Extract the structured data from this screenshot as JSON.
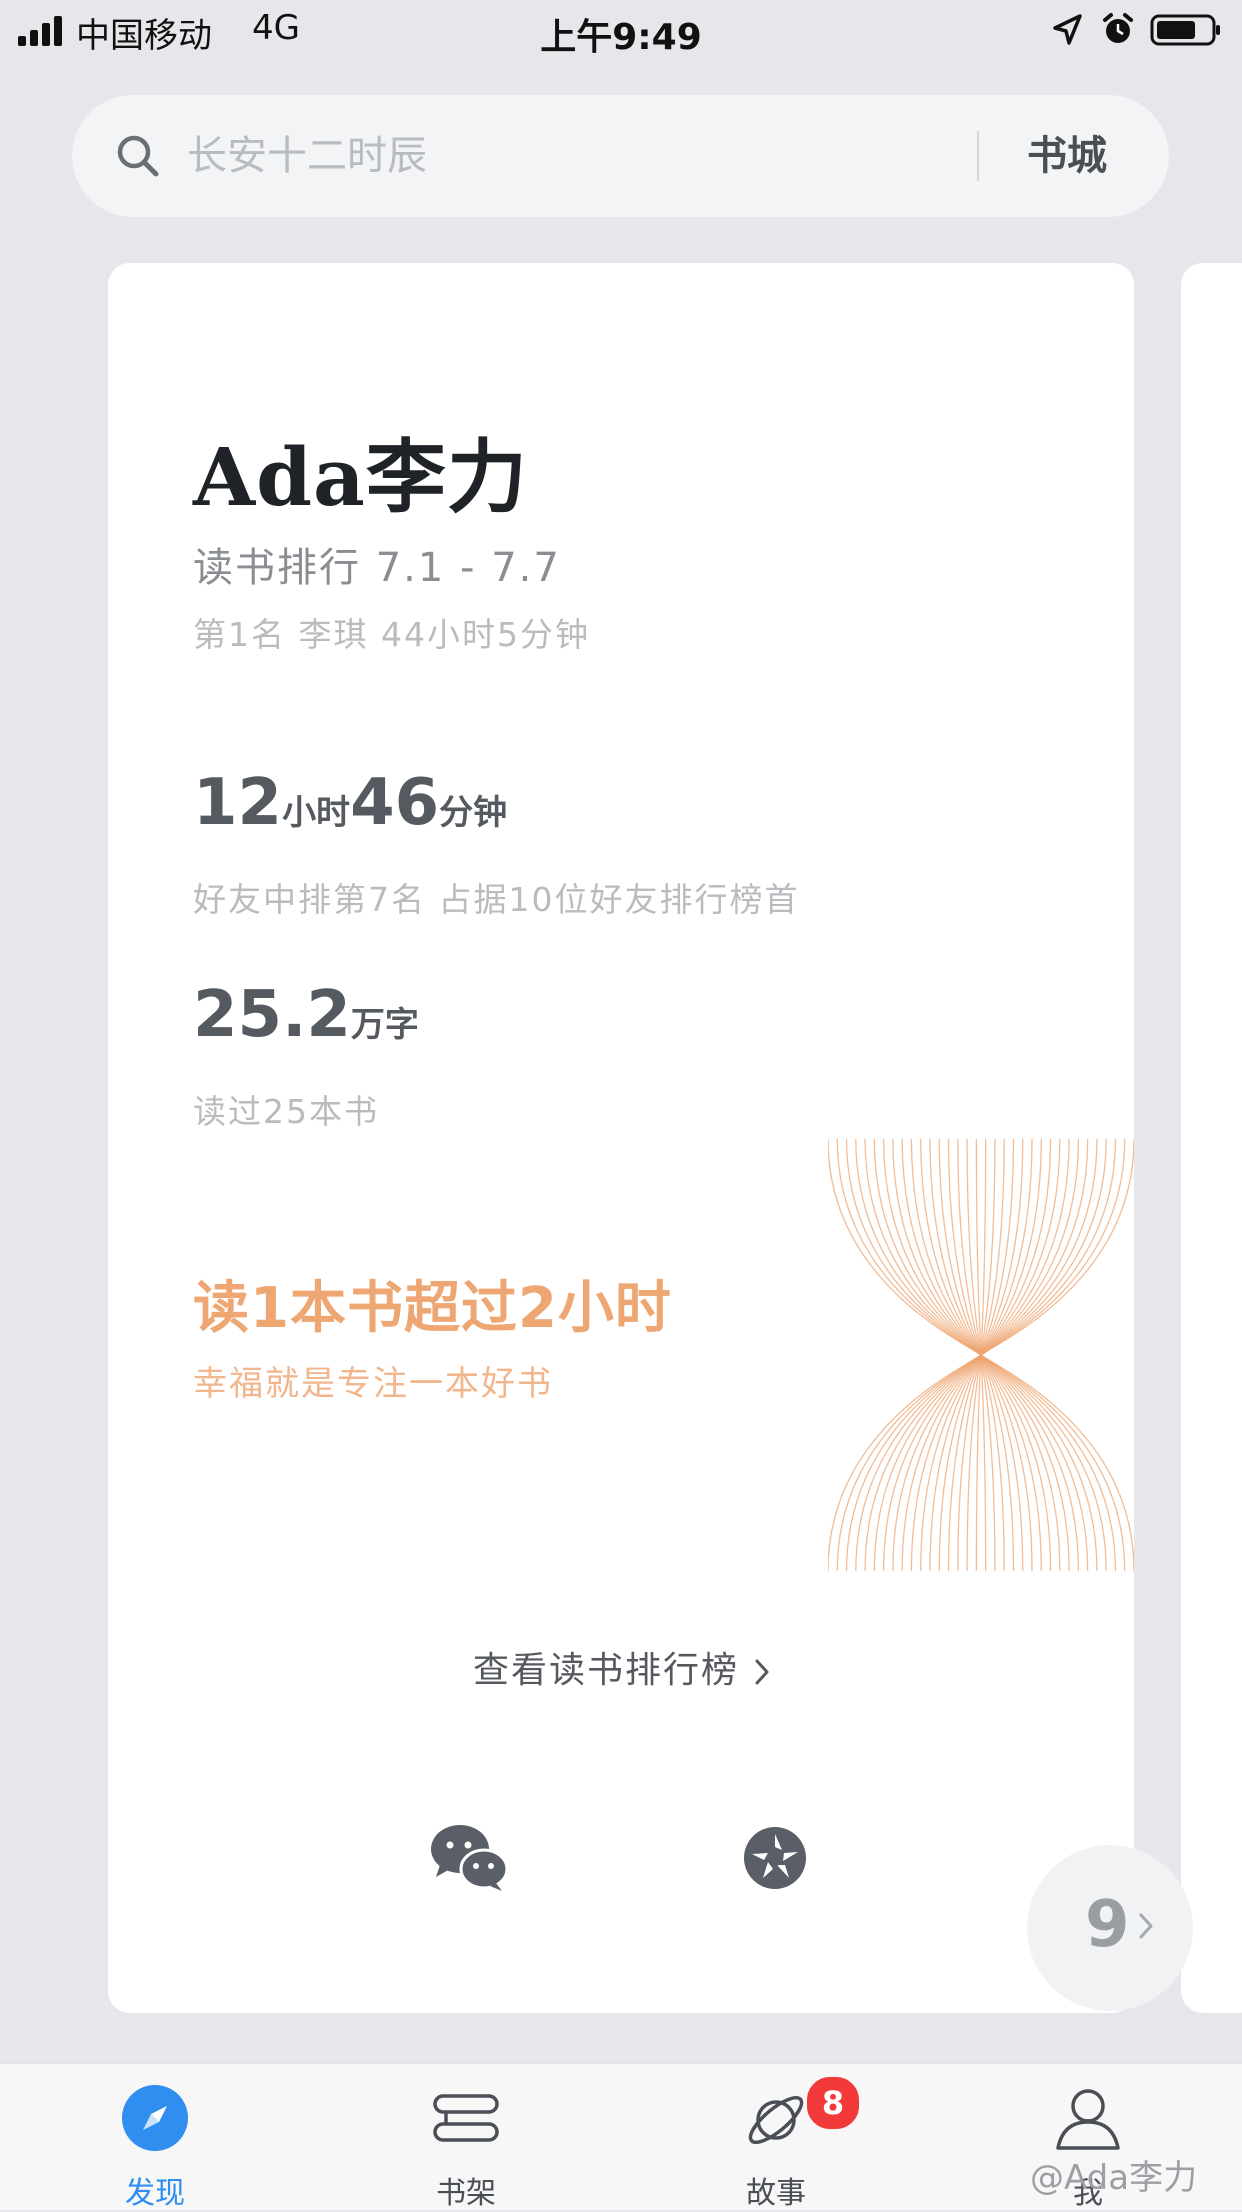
{
  "status_bar": {
    "carrier": "中国移动",
    "network": "4G",
    "time": "上午9:49"
  },
  "search": {
    "placeholder": "长安十二时辰",
    "bookstore_label": "书城"
  },
  "card": {
    "user_name": "Ada李力",
    "rank_title": "读书排行 7.1 - 7.7",
    "rank_first": "第1名 李琪 44小时5分钟",
    "reading_time": {
      "hours": "12",
      "hours_unit": "小时",
      "minutes": "46",
      "minutes_unit": "分钟"
    },
    "time_subtitle": "好友中排第7名 占据10位好友排行榜首",
    "words": {
      "value": "25.2",
      "unit": "万字"
    },
    "words_subtitle": "读过25本书",
    "achievement_title": "读1本书超过2小时",
    "achievement_subtitle": "幸福就是专注一本好书",
    "view_rank_label": "查看读书排行榜",
    "share_icons": [
      "wechat-icon",
      "moments-icon"
    ],
    "accent_color": "#eea672"
  },
  "page_indicator": {
    "number": "9"
  },
  "tab_bar": {
    "tabs": [
      {
        "label": "发现",
        "icon": "compass-icon",
        "active": true
      },
      {
        "label": "书架",
        "icon": "bookshelf-icon",
        "active": false
      },
      {
        "label": "故事",
        "icon": "planet-icon",
        "active": false,
        "badge": "8"
      },
      {
        "label": "我",
        "icon": "person-icon",
        "active": false
      }
    ],
    "active_color": "#2f8ef0"
  },
  "watermark": "@Ada李力"
}
